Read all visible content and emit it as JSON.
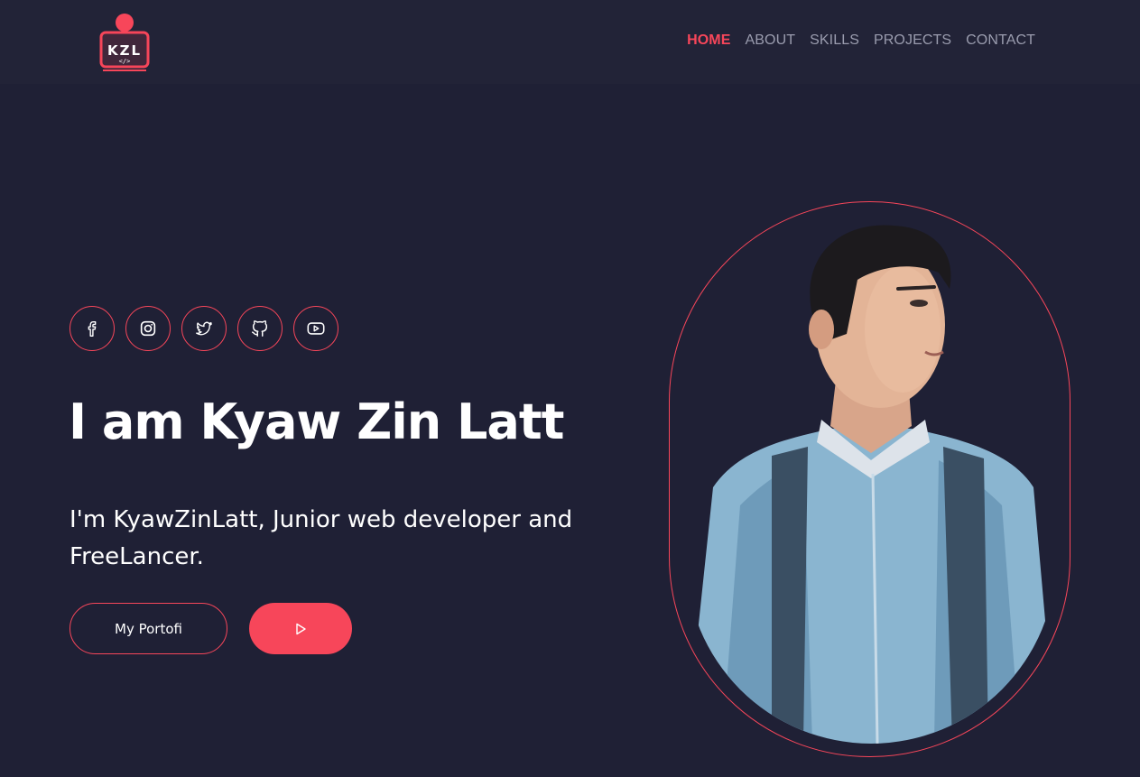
{
  "header": {
    "logo_text": "KZL",
    "nav": [
      {
        "label": "HOME",
        "active": true
      },
      {
        "label": "ABOUT",
        "active": false
      },
      {
        "label": "SKILLS",
        "active": false
      },
      {
        "label": "PROJECTS",
        "active": false
      },
      {
        "label": "CONTACT",
        "active": false
      }
    ]
  },
  "socials": [
    {
      "icon": "facebook-icon"
    },
    {
      "icon": "instagram-icon"
    },
    {
      "icon": "twitter-icon"
    },
    {
      "icon": "github-icon"
    },
    {
      "icon": "youtube-icon"
    }
  ],
  "hero": {
    "title": "I am Kyaw Zin Latt",
    "subtitle": "I'm KyawZinLatt, Junior web developer and FreeLancer.",
    "portfolio_button": "My Portofi",
    "play_button_icon": "play-icon"
  },
  "colors": {
    "background": "#1f2035",
    "header": "#222337",
    "accent": "#f7465a",
    "nav_text": "#9a9cae",
    "text": "#ffffff"
  }
}
